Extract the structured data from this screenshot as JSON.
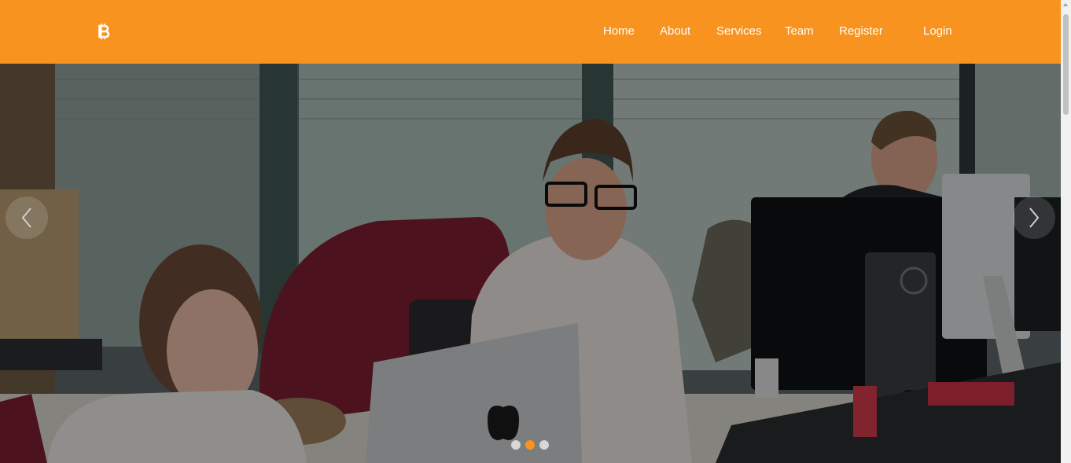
{
  "header": {
    "logo_icon": "bitcoin-icon",
    "brand_color": "#f7931e",
    "nav": [
      {
        "label": "Home"
      },
      {
        "label": "About"
      },
      {
        "label": "Services"
      },
      {
        "label": "Team"
      },
      {
        "label": "Register"
      },
      {
        "label": "Login"
      }
    ]
  },
  "carousel": {
    "prev_icon": "chevron-left-icon",
    "next_icon": "chevron-right-icon",
    "slides_count": 3,
    "active_slide": 2,
    "image": "office workers at computers"
  }
}
